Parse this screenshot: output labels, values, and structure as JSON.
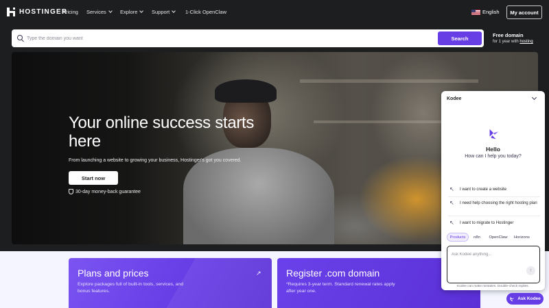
{
  "nav": {
    "logo": "HOSTINGER",
    "items": [
      {
        "label": "Pricing",
        "dropdown": false
      },
      {
        "label": "Services",
        "dropdown": true
      },
      {
        "label": "Explore",
        "dropdown": true
      },
      {
        "label": "Support",
        "dropdown": true
      },
      {
        "label": "1-Click OpenClaw",
        "dropdown": false
      }
    ],
    "language": "English",
    "account_label": "My account"
  },
  "search": {
    "placeholder": "Type the domain you want",
    "button_label": "Search",
    "promo_title": "Free domain",
    "promo_text": "for 1 year with",
    "promo_link": "hosting"
  },
  "hero": {
    "title": "Your online success starts here",
    "subtitle": "From launching a website to growing your business, Hostinger's got you covered.",
    "cta_label": "Start now",
    "guarantee": "30-day money-back guarantee"
  },
  "cards": [
    {
      "title": "Plans and prices",
      "text": "Explore packages full of built-in tools, services, and bonus features.",
      "arrow": "↗"
    },
    {
      "title": "Register .com domain",
      "text": "*Requires 3-year term. Standard renewal rates apply after year one."
    }
  ],
  "chat": {
    "title": "Kodee",
    "greeting": "Hello",
    "question": "How can I help you today?",
    "suggestions": [
      "I want to create a website",
      "I need help choosing the right hosting plan",
      "I want to migrate to Hostinger"
    ],
    "chips": [
      "Products",
      "n8n",
      "OpenClaw",
      "Horizons"
    ],
    "active_chip": "Products",
    "input_placeholder": "Ask Kodee anything...",
    "disclaimer": "Kodee can make mistakes. Double-check replies.",
    "ask_button": "Ask Kodee"
  },
  "colors": {
    "brand": "#673de6",
    "background_dark": "#1d1e20",
    "lower_background": "#f4f5ff"
  }
}
